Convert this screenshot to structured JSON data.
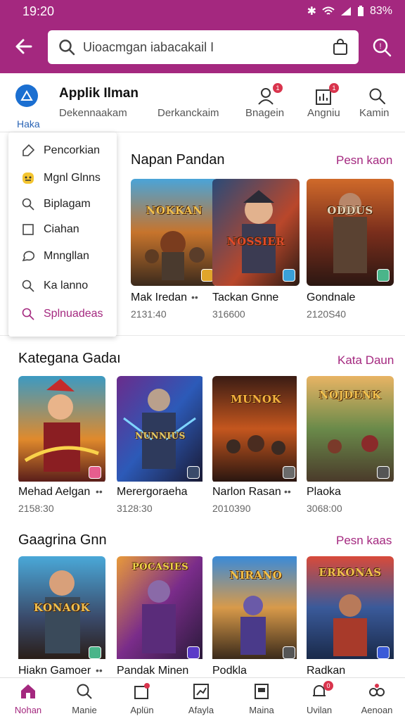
{
  "status": {
    "time": "19:20",
    "battery": "83%"
  },
  "search": {
    "query": "Uioacmgan iabacakail I"
  },
  "app": {
    "home_label": "Haka",
    "name": "Applik Ilman"
  },
  "nav": [
    {
      "label": "Dekennaakam"
    },
    {
      "label": "Derkanckaim"
    },
    {
      "label": "Bnagein",
      "icon": "person-icon",
      "badge": "1"
    },
    {
      "label": "Angniu",
      "icon": "stats-icon",
      "badge": "1"
    },
    {
      "label": "Kamin",
      "icon": "search-icon"
    }
  ],
  "dropdown": [
    {
      "label": "Pencorkian",
      "icon": "tag-icon"
    },
    {
      "label": "Mgnl Glnns",
      "icon": "emoji-icon"
    },
    {
      "label": "Biplagam",
      "icon": "search-icon"
    },
    {
      "label": "Ciahan",
      "icon": "square-icon"
    },
    {
      "label": "Mnngllan",
      "icon": "chat-icon"
    },
    {
      "label": "Ka lanno",
      "icon": "search-icon"
    },
    {
      "label": "Splnuadeas",
      "icon": "search-icon",
      "active": true
    }
  ],
  "sections": [
    {
      "title": "Napan Pandan",
      "link": "Pesn kaon",
      "games": [
        {
          "name": "Mak Iredan",
          "size": "2131:40",
          "art": "NOKKAN"
        },
        {
          "name": "Tackan Gnne",
          "size": "316600",
          "art": "NOSSIER"
        },
        {
          "name": "Gondnale",
          "size": "2120S40",
          "art": "ODDUS"
        }
      ]
    },
    {
      "title": "Kategana Gadaı",
      "link": "Kata Daun",
      "games": [
        {
          "name": "Mehad Aelgan",
          "size": "2158:30",
          "art": ""
        },
        {
          "name": "Merergoraeha",
          "size": "3128:30",
          "art": "NUNNIUS"
        },
        {
          "name": "Narlon Rasan",
          "size": "2010390",
          "art": "MUNOK"
        },
        {
          "name": "Plaoka",
          "size": "3068:00",
          "art": "NOJDENK"
        }
      ]
    },
    {
      "title": "Gaagrina Gnn",
      "link": "Pesn kaas",
      "games": [
        {
          "name": "Hiakn Gamoer",
          "size": "",
          "art": "KONAOK"
        },
        {
          "name": "Pandak Minen",
          "size": "",
          "art": "POCASIES"
        },
        {
          "name": "Podkla",
          "size": "",
          "art": "NIRANO"
        },
        {
          "name": "Radkan",
          "size": "",
          "art": "ERKONAS"
        }
      ]
    }
  ],
  "bottomnav": [
    {
      "label": "Nohan",
      "icon": "home-icon",
      "active": true
    },
    {
      "label": "Manie",
      "icon": "search-icon"
    },
    {
      "label": "Aplün",
      "icon": "app-icon"
    },
    {
      "label": "Afayla",
      "icon": "chart-icon"
    },
    {
      "label": "Maina",
      "icon": "document-icon"
    },
    {
      "label": "Uvilan",
      "icon": "bell-icon",
      "badge": "0"
    },
    {
      "label": "Aenoan",
      "icon": "people-icon"
    }
  ],
  "colors": {
    "accent": "#a4287f",
    "brand_blue": "#1b6fd1"
  }
}
